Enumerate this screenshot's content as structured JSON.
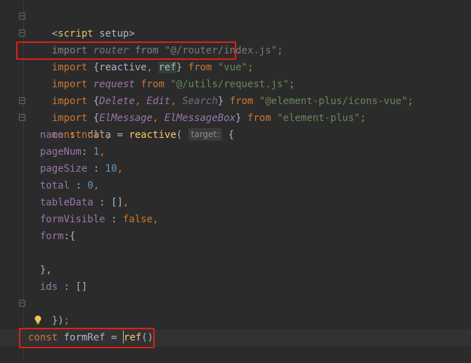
{
  "editor": {
    "lines": {
      "l1": {
        "open": "<",
        "tag": "script",
        "attr": " setup",
        "close": ">"
      },
      "l2": {
        "import": "import",
        "name": "router",
        "from": "from",
        "path": "\"@/router/index.js\"",
        "semi": ";"
      },
      "l3": {
        "import": "import",
        "brace_open": "{",
        "a": "reactive",
        "comma": ", ",
        "b": "ref",
        "brace_close": "}",
        "from": "from",
        "path": "\"vue\"",
        "semi": ";"
      },
      "l4": {
        "import": "import",
        "name": "request",
        "from": "from",
        "path": "\"@/utils/request.js\"",
        "semi": ";"
      },
      "l5": {
        "import": "import",
        "brace_open": "{",
        "a": "Delete",
        "b": "Edit",
        "c": "Search",
        "brace_close": "}",
        "from": "from",
        "path": "\"@element-plus/icons-vue\"",
        "semi": ";"
      },
      "l6": {
        "import": "import",
        "brace_open": "{",
        "a": "ElMessage",
        "b": "ElMessageBox",
        "brace_close": "}",
        "from": "from",
        "path": "\"element-plus\"",
        "semi": ";"
      },
      "l7": {
        "const": "const",
        "name": "data",
        "eq": " = ",
        "fn": "reactive",
        "paren": "(",
        "hint": "target:",
        "brace": " {"
      },
      "l8": {
        "key": "name",
        "sep": " : ",
        "val": "null",
        "comma": ","
      },
      "l9": {
        "key": "pageNum",
        "sep": ": ",
        "val": "1",
        "comma": ","
      },
      "l10": {
        "key": "pageSize",
        "sep": " : ",
        "val": "10",
        "comma": ","
      },
      "l11": {
        "key": "total",
        "sep": " : ",
        "val": "0",
        "comma": ","
      },
      "l12": {
        "key": "tableData",
        "sep": " : ",
        "val": "[]",
        "comma": ","
      },
      "l13": {
        "key": "formVisible",
        "sep": " : ",
        "val": "false",
        "comma": ","
      },
      "l14": {
        "key": "form",
        "sep": ":",
        "val": "{"
      },
      "l15": {
        "text": ""
      },
      "l16": {
        "text": "},"
      },
      "l17": {
        "key": "ids",
        "sep": " : ",
        "val": "[]"
      },
      "l18": {
        "close": "})",
        "semi": ";"
      },
      "l20": {
        "const": "const",
        "name": "formRef",
        "eq": " = ",
        "fn": "ref",
        "paren": "()"
      }
    }
  }
}
